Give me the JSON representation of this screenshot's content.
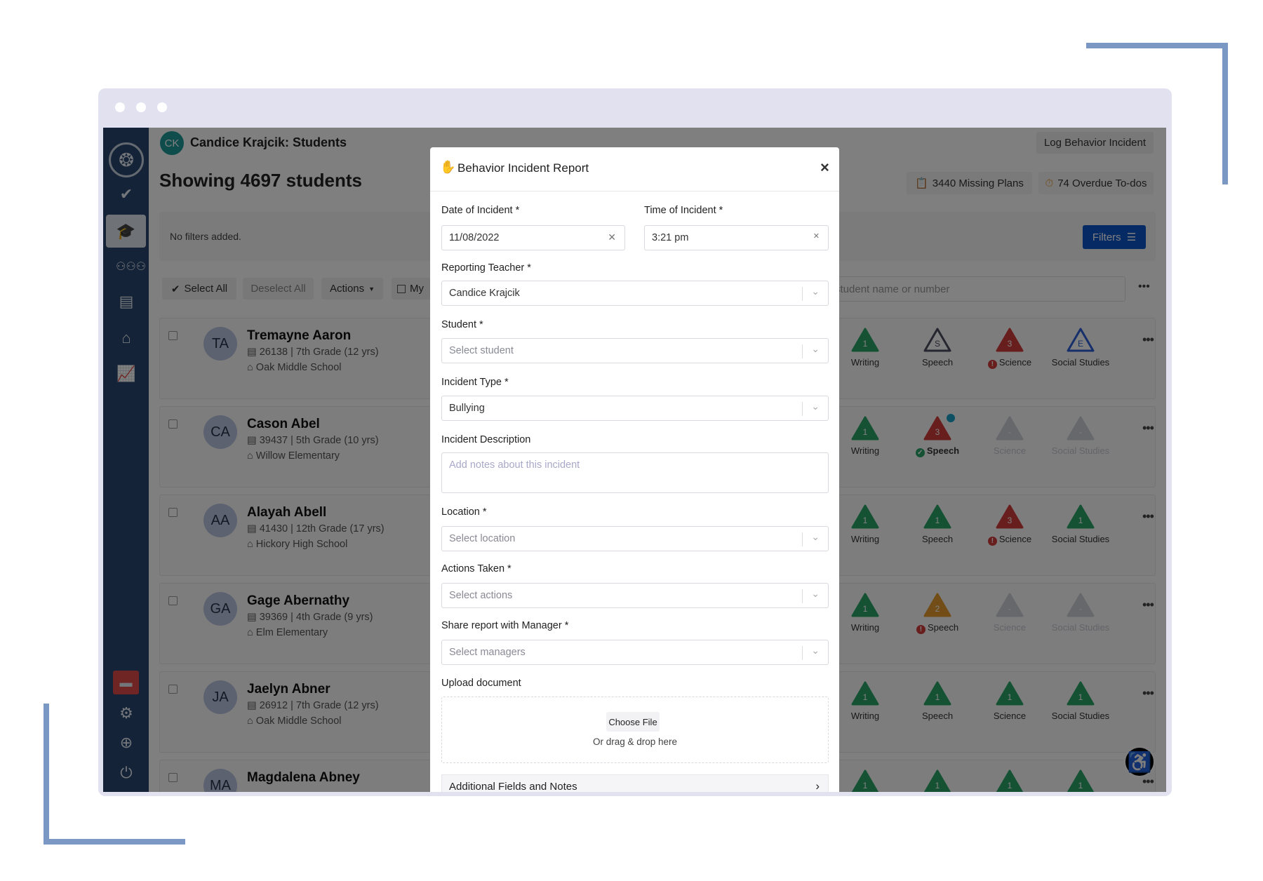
{
  "header": {
    "avatar_initials": "CK",
    "title": "Candice Krajcik: Students",
    "count_heading": "Showing 4697 students",
    "log_button": "Log Behavior Incident",
    "missing_plans": "3440 Missing Plans",
    "overdue_todos": "74 Overdue To-dos",
    "avatar_color": "#1f9a9a"
  },
  "filters": {
    "empty_text": "No filters added.",
    "button": "Filters"
  },
  "toolbar": {
    "select_all": "Select All",
    "deselect_all": "Deselect All",
    "actions": "Actions",
    "my": "My",
    "search_placeholder": "student name or number"
  },
  "subject_colors": {
    "green": "#2aa566",
    "red": "#d23c3c",
    "orange": "#e59a2e",
    "blue": "#2d5fd6",
    "gray": "#c5c7cf",
    "outline_gray": "#4a4d5e"
  },
  "students": [
    {
      "initials": "TA",
      "name": "Tremayne Aaron",
      "details": "26138 | 7th Grade (12 yrs)",
      "school": "Oak Middle School",
      "subjects": [
        {
          "label": "Writing",
          "mark": "1",
          "color": "green"
        },
        {
          "label": "Speech",
          "mark": "S",
          "color": "outline_gray",
          "outline": true
        },
        {
          "label": "Science",
          "mark": "3",
          "color": "red",
          "status": "alert"
        },
        {
          "label": "Social Studies",
          "mark": "E",
          "color": "blue",
          "outline": true
        }
      ]
    },
    {
      "initials": "CA",
      "name": "Cason Abel",
      "details": "39437 | 5th Grade (10 yrs)",
      "school": "Willow Elementary",
      "subjects": [
        {
          "label": "Writing",
          "mark": "1",
          "color": "green"
        },
        {
          "label": "Speech",
          "mark": "3",
          "color": "red",
          "status": "check",
          "badge": "clock"
        },
        {
          "label": "Science",
          "mark": "-",
          "color": "gray",
          "faded": true
        },
        {
          "label": "Social Studies",
          "mark": "-",
          "color": "gray",
          "faded": true
        }
      ]
    },
    {
      "initials": "AA",
      "name": "Alayah Abell",
      "details": "41430 | 12th Grade (17 yrs)",
      "school": "Hickory High School",
      "subjects": [
        {
          "label": "Writing",
          "mark": "1",
          "color": "green"
        },
        {
          "label": "Speech",
          "mark": "1",
          "color": "green"
        },
        {
          "label": "Science",
          "mark": "3",
          "color": "red",
          "status": "alert"
        },
        {
          "label": "Social Studies",
          "mark": "1",
          "color": "green"
        }
      ]
    },
    {
      "initials": "GA",
      "name": "Gage Abernathy",
      "details": "39369 | 4th Grade (9 yrs)",
      "school": "Elm Elementary",
      "subjects": [
        {
          "label": "Writing",
          "mark": "1",
          "color": "green"
        },
        {
          "label": "Speech",
          "mark": "2",
          "color": "orange",
          "status": "alert"
        },
        {
          "label": "Science",
          "mark": "-",
          "color": "gray",
          "faded": true
        },
        {
          "label": "Social Studies",
          "mark": "-",
          "color": "gray",
          "faded": true
        }
      ]
    },
    {
      "initials": "JA",
      "name": "Jaelyn Abner",
      "details": "26912 | 7th Grade (12 yrs)",
      "school": "Oak Middle School",
      "subjects": [
        {
          "label": "Writing",
          "mark": "1",
          "color": "green"
        },
        {
          "label": "Speech",
          "mark": "1",
          "color": "green"
        },
        {
          "label": "Science",
          "mark": "1",
          "color": "green"
        },
        {
          "label": "Social Studies",
          "mark": "1",
          "color": "green"
        }
      ]
    },
    {
      "initials": "MA",
      "name": "Magdalena Abney",
      "subjects": [
        {
          "mark": "1",
          "color": "green"
        },
        {
          "mark": "1",
          "color": "green"
        },
        {
          "mark": "1",
          "color": "green"
        },
        {
          "mark": "1",
          "color": "green"
        }
      ]
    }
  ],
  "modal": {
    "title": "Behavior Incident Report",
    "close": "×",
    "date_label": "Date of Incident *",
    "date_value": "11/08/2022",
    "time_label": "Time of Incident *",
    "time_value": "3:21 pm",
    "teacher_label": "Reporting Teacher *",
    "teacher_value": "Candice Krajcik",
    "student_label": "Student *",
    "student_placeholder": "Select student",
    "type_label": "Incident Type *",
    "type_value": "Bullying",
    "description_label": "Incident Description",
    "description_placeholder": "Add notes about this incident",
    "location_label": "Location *",
    "location_placeholder": "Select location",
    "actions_label": "Actions Taken *",
    "actions_placeholder": "Select actions",
    "share_label": "Share report with Manager *",
    "share_placeholder": "Select managers",
    "upload_label": "Upload document",
    "choose_file": "Choose File",
    "drag_text": "Or drag & drop here",
    "additional": "Additional Fields and Notes"
  }
}
